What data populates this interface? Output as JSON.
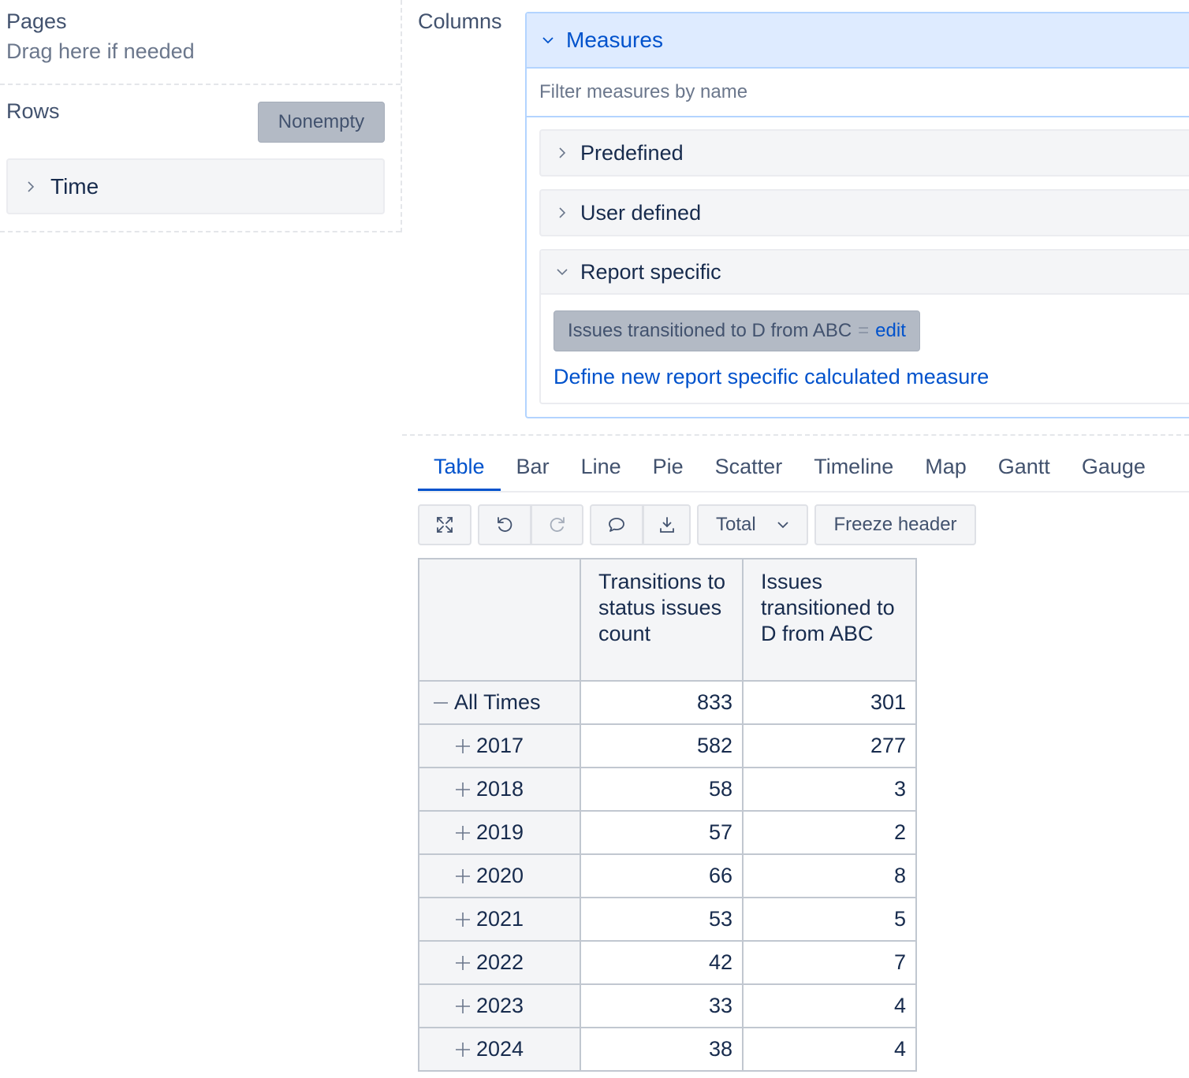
{
  "layout_zones": {
    "pages_title": "Pages",
    "pages_hint": "Drag here if needed",
    "rows_title": "Rows",
    "nonempty_label": "Nonempty",
    "row_dimension": "Time",
    "columns_title": "Columns"
  },
  "measures": {
    "title": "Measures",
    "filter_placeholder": "Filter measures by name",
    "groups": {
      "predefined": "Predefined",
      "user_defined": "User defined",
      "report_specific": "Report specific"
    },
    "selected_measure": {
      "name": "Issues transitioned to D from ABC",
      "equals": "=",
      "edit_label": "edit"
    },
    "define_link": "Define new report specific calculated measure"
  },
  "tabs": [
    "Table",
    "Bar",
    "Line",
    "Pie",
    "Scatter",
    "Timeline",
    "Map",
    "Gantt",
    "Gauge"
  ],
  "active_tab": "Table",
  "toolbar": {
    "icons": [
      "fullscreen-icon",
      "undo-icon",
      "redo-icon",
      "comment-icon",
      "export-icon"
    ],
    "total_label": "Total",
    "freeze_label": "Freeze header"
  },
  "table": {
    "headers": [
      "",
      "Transitions to status issues count",
      "Issues transitioned to D from ABC"
    ],
    "rows": [
      {
        "label": "All Times",
        "toggle": "collapse",
        "v1": "833",
        "v2": "301"
      },
      {
        "label": "2017",
        "toggle": "expand",
        "v1": "582",
        "v2": "277"
      },
      {
        "label": "2018",
        "toggle": "expand",
        "v1": "58",
        "v2": "3"
      },
      {
        "label": "2019",
        "toggle": "expand",
        "v1": "57",
        "v2": "2"
      },
      {
        "label": "2020",
        "toggle": "expand",
        "v1": "66",
        "v2": "8"
      },
      {
        "label": "2021",
        "toggle": "expand",
        "v1": "53",
        "v2": "5"
      },
      {
        "label": "2022",
        "toggle": "expand",
        "v1": "42",
        "v2": "7"
      },
      {
        "label": "2023",
        "toggle": "expand",
        "v1": "33",
        "v2": "4"
      },
      {
        "label": "2024",
        "toggle": "expand",
        "v1": "38",
        "v2": "4"
      }
    ]
  },
  "colors": {
    "accent": "#0052cc",
    "measures_header_bg": "#deebff",
    "chip_bg": "#b3bac5"
  }
}
